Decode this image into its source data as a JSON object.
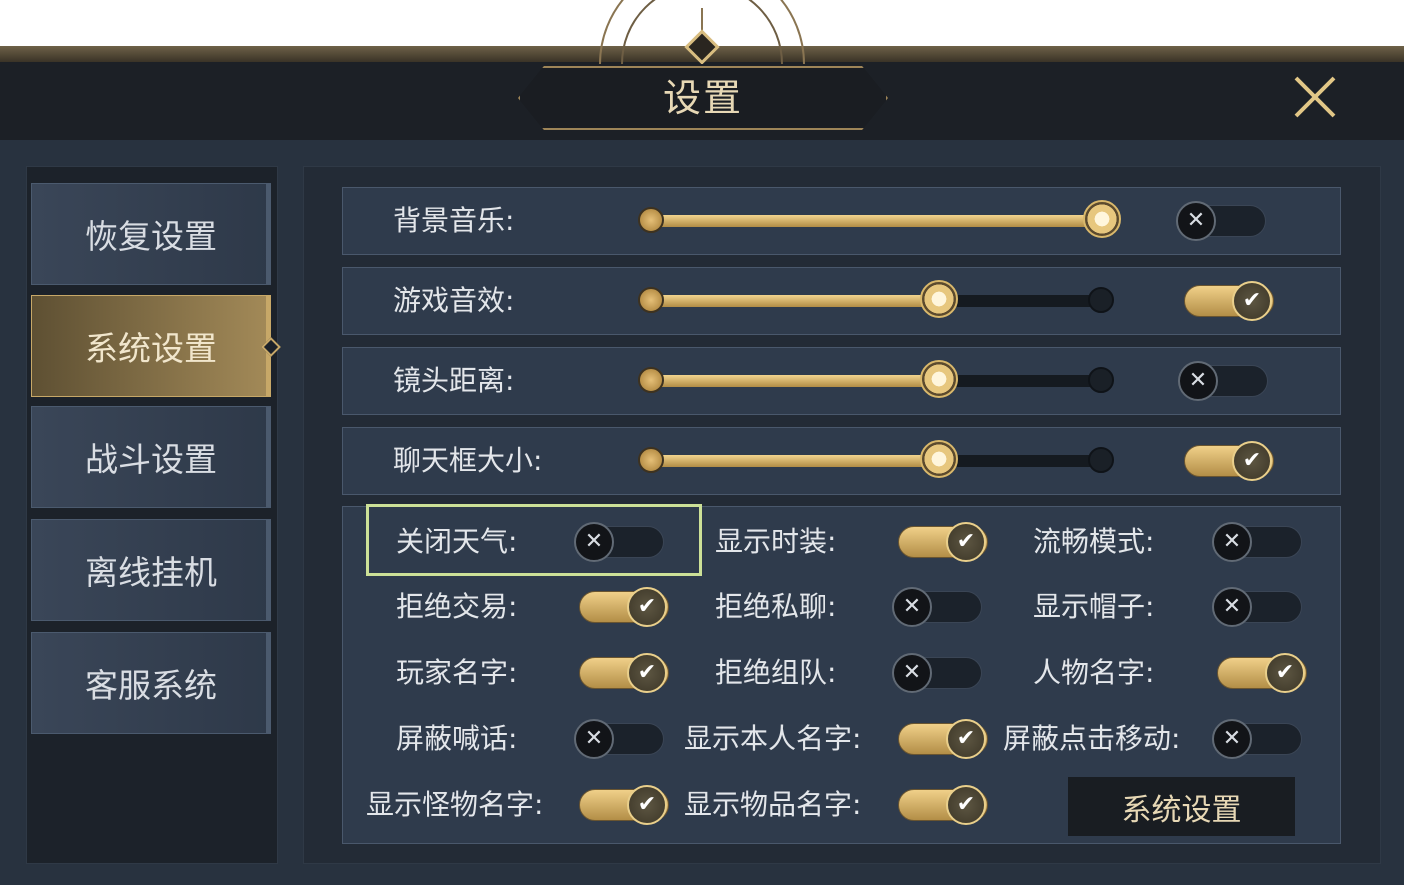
{
  "window": {
    "title": "设置"
  },
  "sidebar": {
    "items": [
      {
        "label": "恢复设置",
        "active": false
      },
      {
        "label": "系统设置",
        "active": true
      },
      {
        "label": "战斗设置",
        "active": false
      },
      {
        "label": "离线挂机",
        "active": false
      },
      {
        "label": "客服系统",
        "active": false
      }
    ]
  },
  "sliders": [
    {
      "label": "背景音乐:",
      "value_percent": 100,
      "enabled": false
    },
    {
      "label": "游戏音效:",
      "value_percent": 64,
      "enabled": true
    },
    {
      "label": "镜头距离:",
      "value_percent": 64,
      "enabled": false
    },
    {
      "label": "聊天框大小:",
      "value_percent": 64,
      "enabled": true
    }
  ],
  "options": [
    {
      "label": "关闭天气:",
      "on": false
    },
    {
      "label": "显示时装:",
      "on": true
    },
    {
      "label": "流畅模式:",
      "on": false
    },
    {
      "label": "拒绝交易:",
      "on": true
    },
    {
      "label": "拒绝私聊:",
      "on": false
    },
    {
      "label": "显示帽子:",
      "on": false
    },
    {
      "label": "玩家名字:",
      "on": true
    },
    {
      "label": "拒绝组队:",
      "on": false
    },
    {
      "label": "人物名字:",
      "on": true
    },
    {
      "label": "屏蔽喊话:",
      "on": false
    },
    {
      "label": "显示本人名字:",
      "on": true
    },
    {
      "label": "屏蔽点击移动:",
      "on": false
    },
    {
      "label": "显示怪物名字:",
      "on": true
    },
    {
      "label": "显示物品名字:",
      "on": true
    }
  ],
  "buttons": {
    "system_settings": "系统设置"
  },
  "icons": {
    "on": "check-icon",
    "off": "x-icon",
    "close": "close-icon"
  },
  "colors": {
    "accent_gold": "#c7a868",
    "highlight": "#cde197",
    "panel": "#2f3b4c"
  }
}
